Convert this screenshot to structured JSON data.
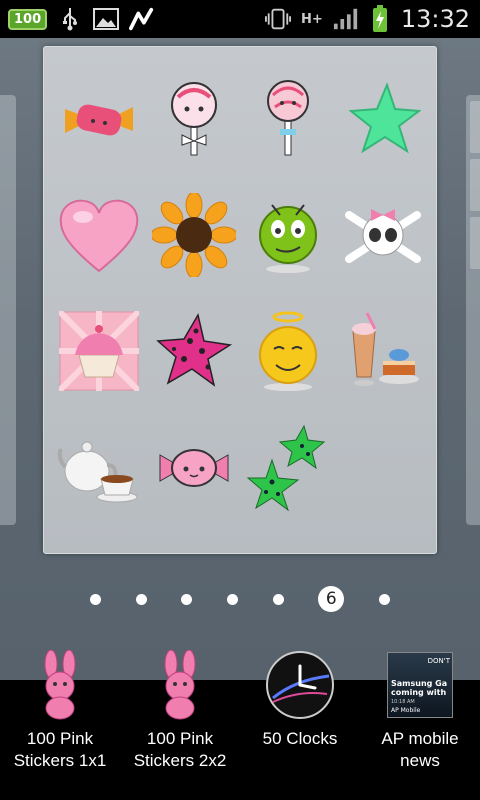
{
  "status_bar": {
    "battery_level": "100",
    "network_type": "H+",
    "time": "13:32",
    "icons": [
      "usb-icon",
      "gallery-icon",
      "app-icon",
      "vibrate-icon",
      "data-arrows-icon",
      "signal-icon",
      "battery-charging-icon"
    ]
  },
  "widget_preview": {
    "stickers": [
      "candy-wrapped",
      "lollipop-bow",
      "lollipop",
      "green-star",
      "pink-heart",
      "sunflower",
      "green-smiley",
      "skull-bow",
      "cupcake",
      "pink-leopard-star",
      "angel-smiley",
      "milkshake-cake",
      "teapot-cup",
      "pink-candy",
      "green-leopard-stars"
    ]
  },
  "pager": {
    "current_page": "6",
    "total_pages": 7,
    "current_index": 5
  },
  "tray": {
    "items": [
      {
        "label_line1": "100 Pink",
        "label_line2": "Stickers 1x1",
        "icon": "pink-bunny-icon"
      },
      {
        "label_line1": "100 Pink",
        "label_line2": "Stickers 2x2",
        "icon": "pink-bunny-icon"
      },
      {
        "label_line1": "50 Clocks",
        "label_line2": "",
        "icon": "clock-icon"
      },
      {
        "label_line1": "AP mobile",
        "label_line2": "news",
        "icon": "ap-news-icon"
      }
    ],
    "ap_thumb_text": {
      "headline": "Samsung Ga coming with",
      "badge": "AP Mobile",
      "time": "10:18 AM",
      "side": "DON'T"
    }
  },
  "colors": {
    "background": "#5d6872",
    "panel": "#c0c4c8",
    "accent_green": "#5aa52a",
    "pink": "#f07fb0"
  }
}
